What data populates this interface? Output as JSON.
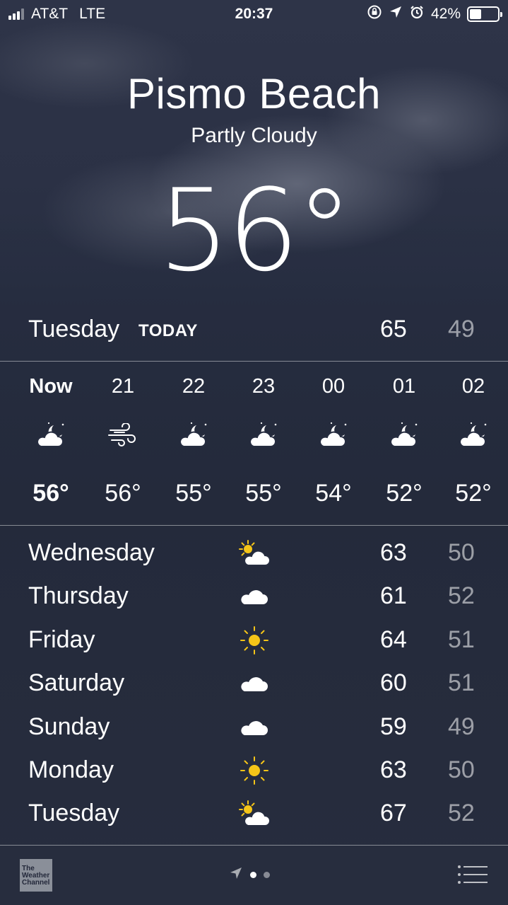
{
  "status_bar": {
    "carrier": "AT&T",
    "network": "LTE",
    "time": "20:37",
    "battery_percent": "42%",
    "battery_level": 0.42,
    "icons": [
      "orientation-lock-icon",
      "location-arrow-icon",
      "alarm-icon"
    ]
  },
  "location": {
    "city": "Pismo Beach",
    "condition": "Partly Cloudy",
    "current_temp": "56°"
  },
  "today": {
    "day": "Tuesday",
    "tag": "TODAY",
    "high": "65",
    "low": "49"
  },
  "hourly": [
    {
      "label": "Now",
      "icon": "partly-cloudy-night-icon",
      "temp": "56°"
    },
    {
      "label": "21",
      "icon": "wind-icon",
      "temp": "56°"
    },
    {
      "label": "22",
      "icon": "partly-cloudy-night-icon",
      "temp": "55°"
    },
    {
      "label": "23",
      "icon": "partly-cloudy-night-icon",
      "temp": "55°"
    },
    {
      "label": "00",
      "icon": "partly-cloudy-night-icon",
      "temp": "54°"
    },
    {
      "label": "01",
      "icon": "partly-cloudy-night-icon",
      "temp": "52°"
    },
    {
      "label": "02",
      "icon": "partly-cloudy-night-icon",
      "temp": "52°"
    }
  ],
  "daily": [
    {
      "day": "Wednesday",
      "icon": "partly-sunny-icon",
      "high": "63",
      "low": "50"
    },
    {
      "day": "Thursday",
      "icon": "cloud-icon",
      "high": "61",
      "low": "52"
    },
    {
      "day": "Friday",
      "icon": "sun-icon",
      "high": "64",
      "low": "51"
    },
    {
      "day": "Saturday",
      "icon": "cloud-icon",
      "high": "60",
      "low": "51"
    },
    {
      "day": "Sunday",
      "icon": "cloud-icon",
      "high": "59",
      "low": "49"
    },
    {
      "day": "Monday",
      "icon": "sun-icon",
      "high": "63",
      "low": "50"
    },
    {
      "day": "Tuesday",
      "icon": "partly-sunny-icon",
      "high": "67",
      "low": "52"
    }
  ],
  "bottom_bar": {
    "logo_text": "The Weather Channel",
    "logo_lines": [
      "The",
      "Weather",
      "Channel"
    ],
    "page_indicators": [
      "location-arrow-icon",
      "current-page-dot",
      "other-page-dot"
    ]
  },
  "colors": {
    "background": "#262d40",
    "low_temp": "#ffffff8c",
    "sun": "#f5c518"
  }
}
